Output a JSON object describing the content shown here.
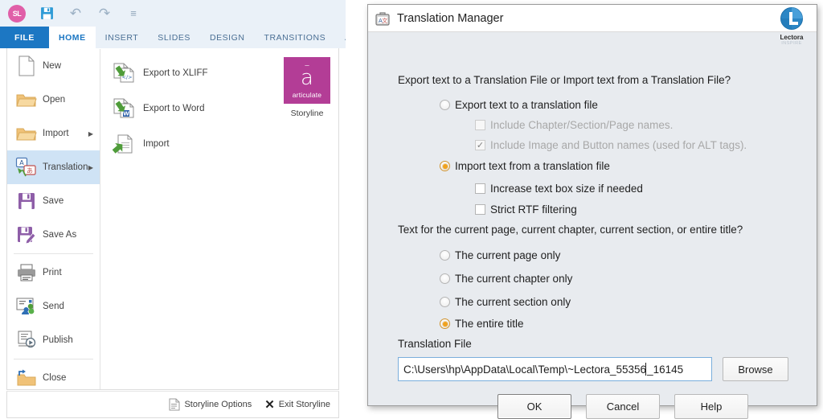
{
  "storyline": {
    "quick_access": {
      "logo_text": "SL",
      "save_icon": "save-icon",
      "undo_icon": "undo-arrow-icon",
      "redo_icon": "redo-arrow-icon",
      "more_icon": "customize-qat-icon"
    },
    "ribbon_tabs": [
      {
        "label": "FILE",
        "state": "file"
      },
      {
        "label": "HOME",
        "state": "active"
      },
      {
        "label": "INSERT",
        "state": "normal"
      },
      {
        "label": "SLIDES",
        "state": "normal"
      },
      {
        "label": "DESIGN",
        "state": "normal"
      },
      {
        "label": "TRANSITIONS",
        "state": "normal"
      },
      {
        "label": "AI",
        "state": "truncated"
      }
    ],
    "file_menu": [
      {
        "label": "New",
        "icon": "new-document-icon",
        "caret": "",
        "selected": false
      },
      {
        "label": "Open",
        "icon": "open-folder-icon",
        "caret": "",
        "selected": false
      },
      {
        "label": "Import",
        "icon": "import-folder-icon",
        "caret": "▶",
        "selected": false
      },
      {
        "label": "Translation",
        "icon": "translation-icon",
        "caret": "▶",
        "selected": true
      },
      {
        "label": "Save",
        "icon": "save-disk-icon",
        "caret": "",
        "selected": false
      },
      {
        "label": "Save As",
        "icon": "save-as-disk-icon",
        "caret": "",
        "selected": false
      },
      {
        "label": "Print",
        "icon": "printer-icon",
        "caret": "",
        "selected": false
      },
      {
        "label": "Send",
        "icon": "send-people-icon",
        "caret": "",
        "selected": false
      },
      {
        "label": "Publish",
        "icon": "publish-play-icon",
        "caret": "",
        "selected": false
      },
      {
        "label": "Close",
        "icon": "close-folder-icon",
        "caret": "",
        "selected": false
      }
    ],
    "translation_pane": [
      {
        "label": "Export to XLIFF",
        "icon": "export-xliff-icon"
      },
      {
        "label": "Export to Word",
        "icon": "export-word-icon"
      },
      {
        "label": "Import",
        "icon": "import-document-icon"
      }
    ],
    "product_tile": {
      "brand": "articulate",
      "glyph": "a",
      "caption": "Storyline",
      "color": "#b33d96"
    },
    "footer": {
      "options_label": "Storyline Options",
      "options_icon": "options-document-icon",
      "exit_label": "Exit Storyline",
      "exit_icon": "close-x-icon"
    }
  },
  "dialog": {
    "title": "Translation Manager",
    "title_icon": "translation-bag-icon",
    "brand": {
      "name": "Lectora",
      "sub": "INSPIRE",
      "icon": "lectora-logo-icon",
      "color": "#2b86c5"
    },
    "question_export_import": "Export text to a Translation File or Import text from a Translation File?",
    "mode_options": [
      {
        "label": "Export text to a translation file",
        "checked": false,
        "disabled": false
      },
      {
        "label": "Import text from a translation file",
        "checked": true,
        "disabled": false
      }
    ],
    "export_sub_options": [
      {
        "label": "Include Chapter/Section/Page names.",
        "checked": false,
        "disabled": true
      },
      {
        "label": "Include Image and Button names (used for ALT tags).",
        "checked": true,
        "disabled": true
      }
    ],
    "import_sub_options": [
      {
        "label": "Increase text box size if needed",
        "checked": false,
        "disabled": false
      },
      {
        "label": "Strict RTF filtering",
        "checked": false,
        "disabled": false
      }
    ],
    "question_scope": "Text for the current page, current chapter, current section, or entire title?",
    "scope_options": [
      {
        "label": "The current page only",
        "checked": false
      },
      {
        "label": "The current chapter only",
        "checked": false
      },
      {
        "label": "The current section only",
        "checked": false
      },
      {
        "label": "The entire title",
        "checked": true
      }
    ],
    "translation_file": {
      "label": "Translation File",
      "value": "C:\\Users\\hp\\AppData\\Local\\Temp\\~Lectora_55356",
      "value_tail": "_16145",
      "browse_label": "Browse"
    },
    "buttons": {
      "ok": "OK",
      "cancel": "Cancel",
      "help": "Help"
    }
  }
}
